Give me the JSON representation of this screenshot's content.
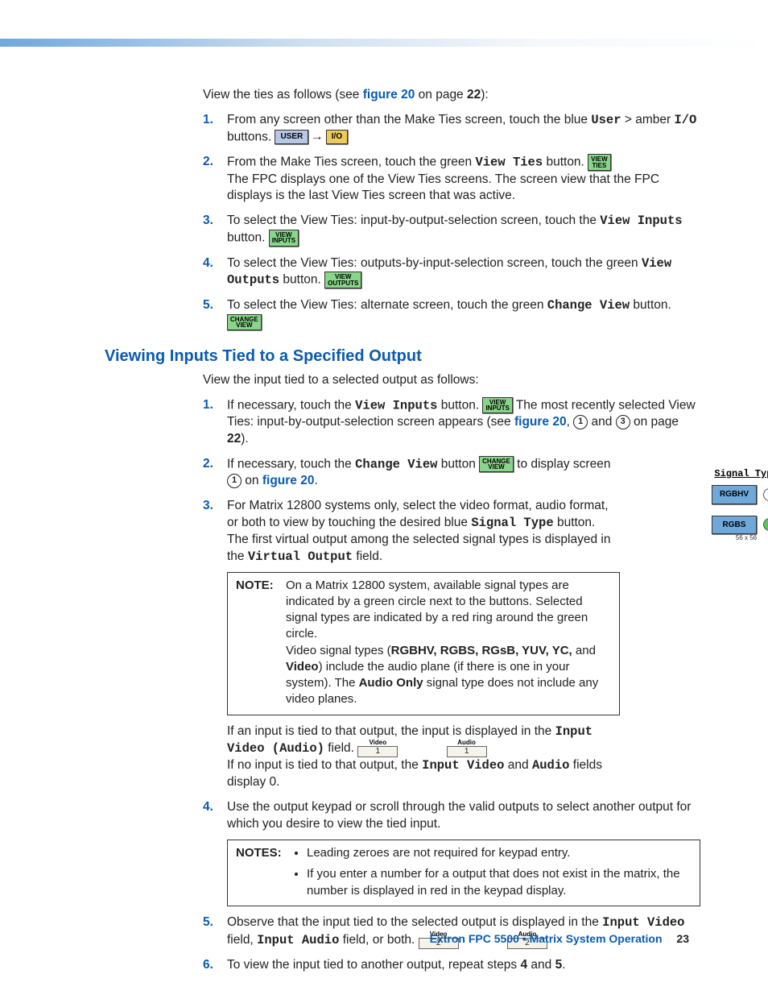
{
  "footer": {
    "product": "Extron FPC 5500 • Matrix System Operation",
    "page": "23"
  },
  "sec1": {
    "intro_a": "View the ties as follows (see ",
    "intro_link": "figure 20",
    "intro_b": " on page ",
    "intro_pg": "22",
    "intro_c": "):",
    "items": [
      {
        "a": "From any screen other than the Make Ties screen, touch the blue ",
        "m1": "User",
        "sep": " > amber ",
        "m2": "I/O",
        "b": " buttons.",
        "btn1": "USER",
        "btn2": "I/O"
      },
      {
        "a": "From the Make Ties screen, touch the green ",
        "m1": "View Ties",
        "b": " button. ",
        "btn": "VIEW\nTIES",
        "c": "The FPC displays one of the View Ties screens. The screen view that the FPC displays is the last View Ties screen that was active."
      },
      {
        "a": "To select the View Ties: input-by-output-selection screen, touch the ",
        "m1": "View Inputs",
        "b": " button. ",
        "btn": "VIEW\nINPUTS"
      },
      {
        "a": "To select the View Ties: outputs-by-input-selection screen, touch the green ",
        "m1": "View Outputs",
        "b": " button. ",
        "btn": "VIEW\nOUTPUTS"
      },
      {
        "a": "To select the View Ties: alternate screen, touch the green ",
        "m1": "Change View",
        "b": " button.",
        "btn": "CHANGE\nVIEW"
      }
    ]
  },
  "sec2": {
    "heading": "Viewing Inputs Tied to a Specified Output",
    "intro": "View the input tied to a selected output as follows:",
    "sigpanel": {
      "title": "Signal Type",
      "b1": "RGBHV",
      "b2": "RGBS",
      "sub": "56 x 56"
    },
    "items": {
      "i1": {
        "a": "If necessary, touch the ",
        "m": "View Inputs",
        "b": " button. ",
        "btn": "VIEW\nINPUTS",
        "c": " The most recently selected View Ties: input-by-output-selection screen appears (see ",
        "link": "figure 20",
        "d": ", ",
        "c1": "1",
        "e": " and ",
        "c2": "3",
        "f": " on page ",
        "pg": "22",
        "g": ")."
      },
      "i2": {
        "a": "If necessary, touch the ",
        "m": "Change View",
        "b": " button ",
        "btn": "CHANGE\nVIEW",
        "c": " to display screen ",
        "c1": "1",
        "d": " on ",
        "link": "figure 20",
        "e": "."
      },
      "i3": {
        "a": "For Matrix 12800 systems only, select the video format, audio format, or both to view by touching the desired blue ",
        "m1": "Signal Type",
        "b": " button. The first virtual output among the selected signal types is displayed in the ",
        "m2": "Virtual Output",
        "c": " field."
      },
      "note1": {
        "label": "NOTE:",
        "l1": "On a Matrix 12800 system, available signal types are indicated by a green circle next to the buttons. Selected signal types are indicated by a red ring around the green circle.",
        "l2a": "Video signal types (",
        "l2b": "RGBHV, RGBS, RGsB, YUV, YC,",
        "l2c": " and ",
        "l2d": "Video",
        "l2e": ") include the audio plane (if there is one in your system). The ",
        "l2f": "Audio Only",
        "l2g": " signal type does not include any video planes."
      },
      "after3": {
        "a": "If an input is tied to that output, the input is displayed in the ",
        "m": "Input Video (Audio)",
        "b": " field.",
        "f1l": "Video",
        "f1v": "1",
        "f2l": "Audio",
        "f2v": "1",
        "c": "If no input is tied to that output, the ",
        "m2": "Input Video",
        "d": " and ",
        "m3": "Audio",
        "e": " fields display 0."
      },
      "i4": "Use the output keypad or scroll through the valid outputs to select another output for which you desire to view the tied input.",
      "note2": {
        "label": "NOTES:",
        "b1": "Leading zeroes are not required for keypad entry.",
        "b2": "If you enter a number for a output that does not exist in the matrix, the number is displayed in red in the keypad display."
      },
      "i5": {
        "a": "Observe that the input tied to the selected output is displayed in the ",
        "m1": "Input Video",
        "b": " field, ",
        "m2": "Input Audio",
        "c": " field, or both.",
        "f1l": "Video",
        "f1v": "2",
        "f2l": "Audio",
        "f2v": "2"
      },
      "i6": {
        "a": "To view the input tied to another output, repeat steps ",
        "s1": "4",
        "b": " and ",
        "s2": "5",
        "c": "."
      }
    }
  }
}
